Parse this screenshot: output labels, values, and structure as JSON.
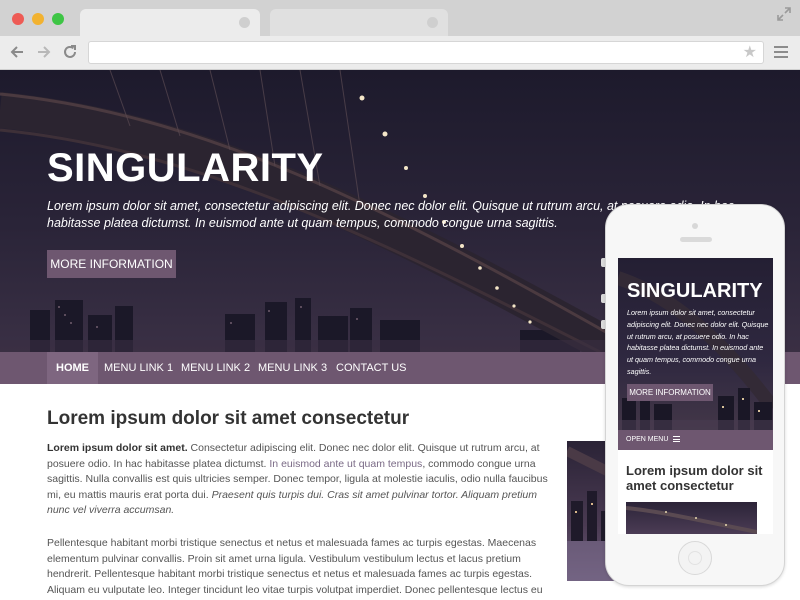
{
  "browser": {
    "icons": [
      "back-arrow-icon",
      "forward-arrow-icon",
      "reload-icon",
      "star-icon",
      "menu-icon",
      "expand-icon"
    ],
    "url": ""
  },
  "hero": {
    "title": "SINGULARITY",
    "text": "Lorem ipsum dolor sit amet, consectetur adipiscing elit. Donec nec dolor elit. Quisque ut rutrum arcu, at posuere odio. In hac habitasse platea dictumst. In euismod ante ut quam tempus, commodo congue urna sagittis.",
    "button": "MORE INFORMATION"
  },
  "nav": {
    "items": [
      "HOME",
      "MENU LINK 1",
      "MENU LINK 2",
      "MENU LINK 3",
      "CONTACT US"
    ]
  },
  "content": {
    "title": "Lorem ipsum dolor sit amet consectetur",
    "p1_bold": "Lorem ipsum dolor sit amet.",
    "p1_text": " Consectetur adipiscing elit. Donec nec dolor elit. Quisque ut rutrum arcu, at posuere odio. In hac habitasse platea dictumst. ",
    "p1_link": "In euismod ante ut quam tempus",
    "p1_text2": ", commodo congue urna sagittis. Nulla convallis est quis ultricies semper. Donec tempor, ligula at molestie iaculis, odio nulla faucibus mi, eu mattis mauris erat porta dui. ",
    "p1_italic": "Praesent quis turpis dui. Cras sit amet pulvinar tortor. Aliquam pretium nunc vel viverra accumsan.",
    "p2": "Pellentesque habitant morbi tristique senectus et netus et malesuada fames ac turpis egestas. Maecenas elementum pulvinar convallis. Proin sit amet urna ligula. Vestibulum vestibulum lectus et lacus pretium hendrerit. Pellentesque habitant morbi tristique senectus et netus et malesuada fames ac turpis egestas. Aliquam eu vulputate leo. Integer tincidunt leo vitae turpis volutpat imperdiet. Donec pellentesque lectus eu suscipit"
  },
  "mobile": {
    "title": "SINGULARITY",
    "text": "Lorem ipsum dolor sit amet, consectetur adipiscing elit. Donec nec dolor elit. Quisque ut rutrum arcu, at posuere odio. In hac habitasse platea dictumst. In euismod ante ut quam tempus, commodo congue urna sagittis.",
    "button": "MORE INFORMATION",
    "menu": "OPEN MENU",
    "heading": "Lorem ipsum dolor sit amet consectetur"
  },
  "colors": {
    "accent": "#6e5770",
    "accent_active": "#7e6680"
  }
}
